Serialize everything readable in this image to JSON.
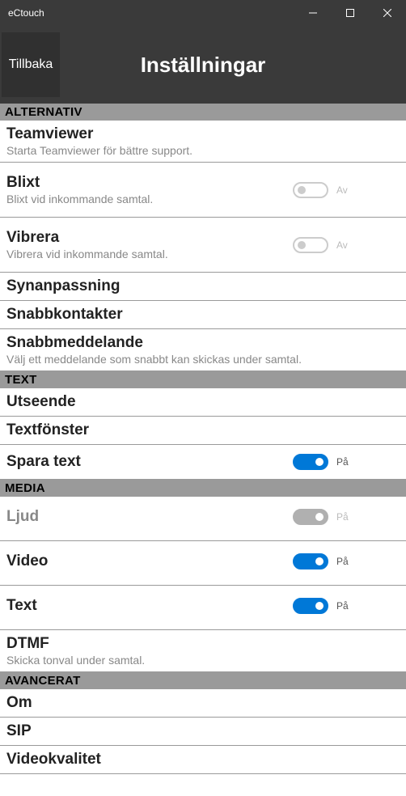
{
  "window": {
    "title": "eCtouch"
  },
  "header": {
    "back_label": "Tillbaka",
    "title": "Inställningar"
  },
  "sections": {
    "alternativ": {
      "header": "ALTERNATIV",
      "teamviewer": {
        "title": "Teamviewer",
        "subtitle": "Starta Teamviewer för bättre support."
      },
      "blixt": {
        "title": "Blixt",
        "subtitle": "Blixt vid inkommande samtal.",
        "state_label": "Av"
      },
      "vibrera": {
        "title": "Vibrera",
        "subtitle": "Vibrera vid inkommande samtal.",
        "state_label": "Av"
      },
      "synanpassning": {
        "title": "Synanpassning"
      },
      "snabbkontakter": {
        "title": "Snabbkontakter"
      },
      "snabbmeddelande": {
        "title": "Snabbmeddelande",
        "subtitle": "Välj ett meddelande som snabbt kan skickas under samtal."
      }
    },
    "text": {
      "header": "TEXT",
      "utseende": {
        "title": "Utseende"
      },
      "textfonster": {
        "title": "Textfönster"
      },
      "spara_text": {
        "title": "Spara text",
        "state_label": "På"
      }
    },
    "media": {
      "header": "MEDIA",
      "ljud": {
        "title": "Ljud",
        "state_label": "På"
      },
      "video": {
        "title": "Video",
        "state_label": "På"
      },
      "text": {
        "title": "Text",
        "state_label": "På"
      },
      "dtmf": {
        "title": "DTMF",
        "subtitle": "Skicka tonval under samtal."
      }
    },
    "avancerat": {
      "header": "AVANCERAT",
      "om": {
        "title": "Om"
      },
      "sip": {
        "title": "SIP"
      },
      "videokvalitet": {
        "title": "Videokvalitet"
      }
    }
  }
}
